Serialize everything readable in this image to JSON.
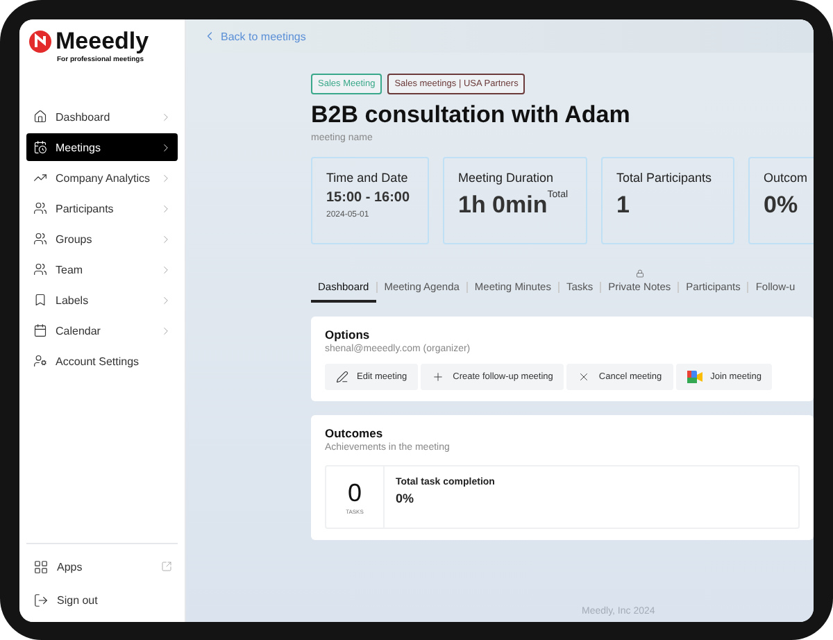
{
  "brand": {
    "name": "Meeedly",
    "tagline": "For professional meetings"
  },
  "sidebar": {
    "items": [
      {
        "label": "Dashboard",
        "selected": false
      },
      {
        "label": "Meetings",
        "selected": true
      },
      {
        "label": "Company Analytics",
        "selected": false
      },
      {
        "label": "Participants",
        "selected": false
      },
      {
        "label": "Groups",
        "selected": false
      },
      {
        "label": "Team",
        "selected": false
      },
      {
        "label": "Labels",
        "selected": false
      },
      {
        "label": "Calendar",
        "selected": false
      },
      {
        "label": "Account Settings",
        "selected": false
      }
    ],
    "bottom": [
      {
        "label": "Apps"
      },
      {
        "label": "Sign out"
      }
    ]
  },
  "back_link": "Back to meetings",
  "tags": [
    {
      "label": "Sales Meeting",
      "color": "#3aa88a"
    },
    {
      "label": "Sales meetings | USA Partners",
      "color": "#6b3a3a"
    }
  ],
  "title": "B2B consultation with Adam",
  "subtitle": "meeting name",
  "stats": [
    {
      "label": "Time and Date",
      "value": "15:00 - 16:00",
      "note": "2024-05-01",
      "kind": "time"
    },
    {
      "label": "Meeting Duration",
      "value": "1h 0min$^{Total}$",
      "kind": "big"
    },
    {
      "label": "Total Participants",
      "value": "1",
      "kind": "big"
    },
    {
      "label": "Outcom",
      "value": "0%",
      "kind": "big"
    }
  ],
  "tabs": [
    {
      "label": "Dashboard",
      "selected": true,
      "locked": false
    },
    {
      "label": "Meeting Agenda",
      "selected": false,
      "locked": false
    },
    {
      "label": "Meeting Minutes",
      "selected": false,
      "locked": false
    },
    {
      "label": "Tasks",
      "selected": false,
      "locked": false
    },
    {
      "label": "Private Notes",
      "selected": false,
      "locked": true
    },
    {
      "label": "Participants",
      "selected": false,
      "locked": false
    },
    {
      "label": "Follow-u",
      "selected": false,
      "locked": false
    }
  ],
  "options": {
    "title": "Options",
    "organizer": "shenal@meeedly.com (organizer)",
    "buttons": [
      "Edit meeting",
      "Create follow-up meeting",
      "Cancel meeting",
      "Join meeting"
    ]
  },
  "outcomes": {
    "title": "Outcomes",
    "subtitle": "Achievements in the meeting",
    "count": "0",
    "count_label": "TASKS",
    "metric_label": "Total task completion",
    "metric_value": "0%"
  },
  "footer": "Meedly, Inc 2024"
}
